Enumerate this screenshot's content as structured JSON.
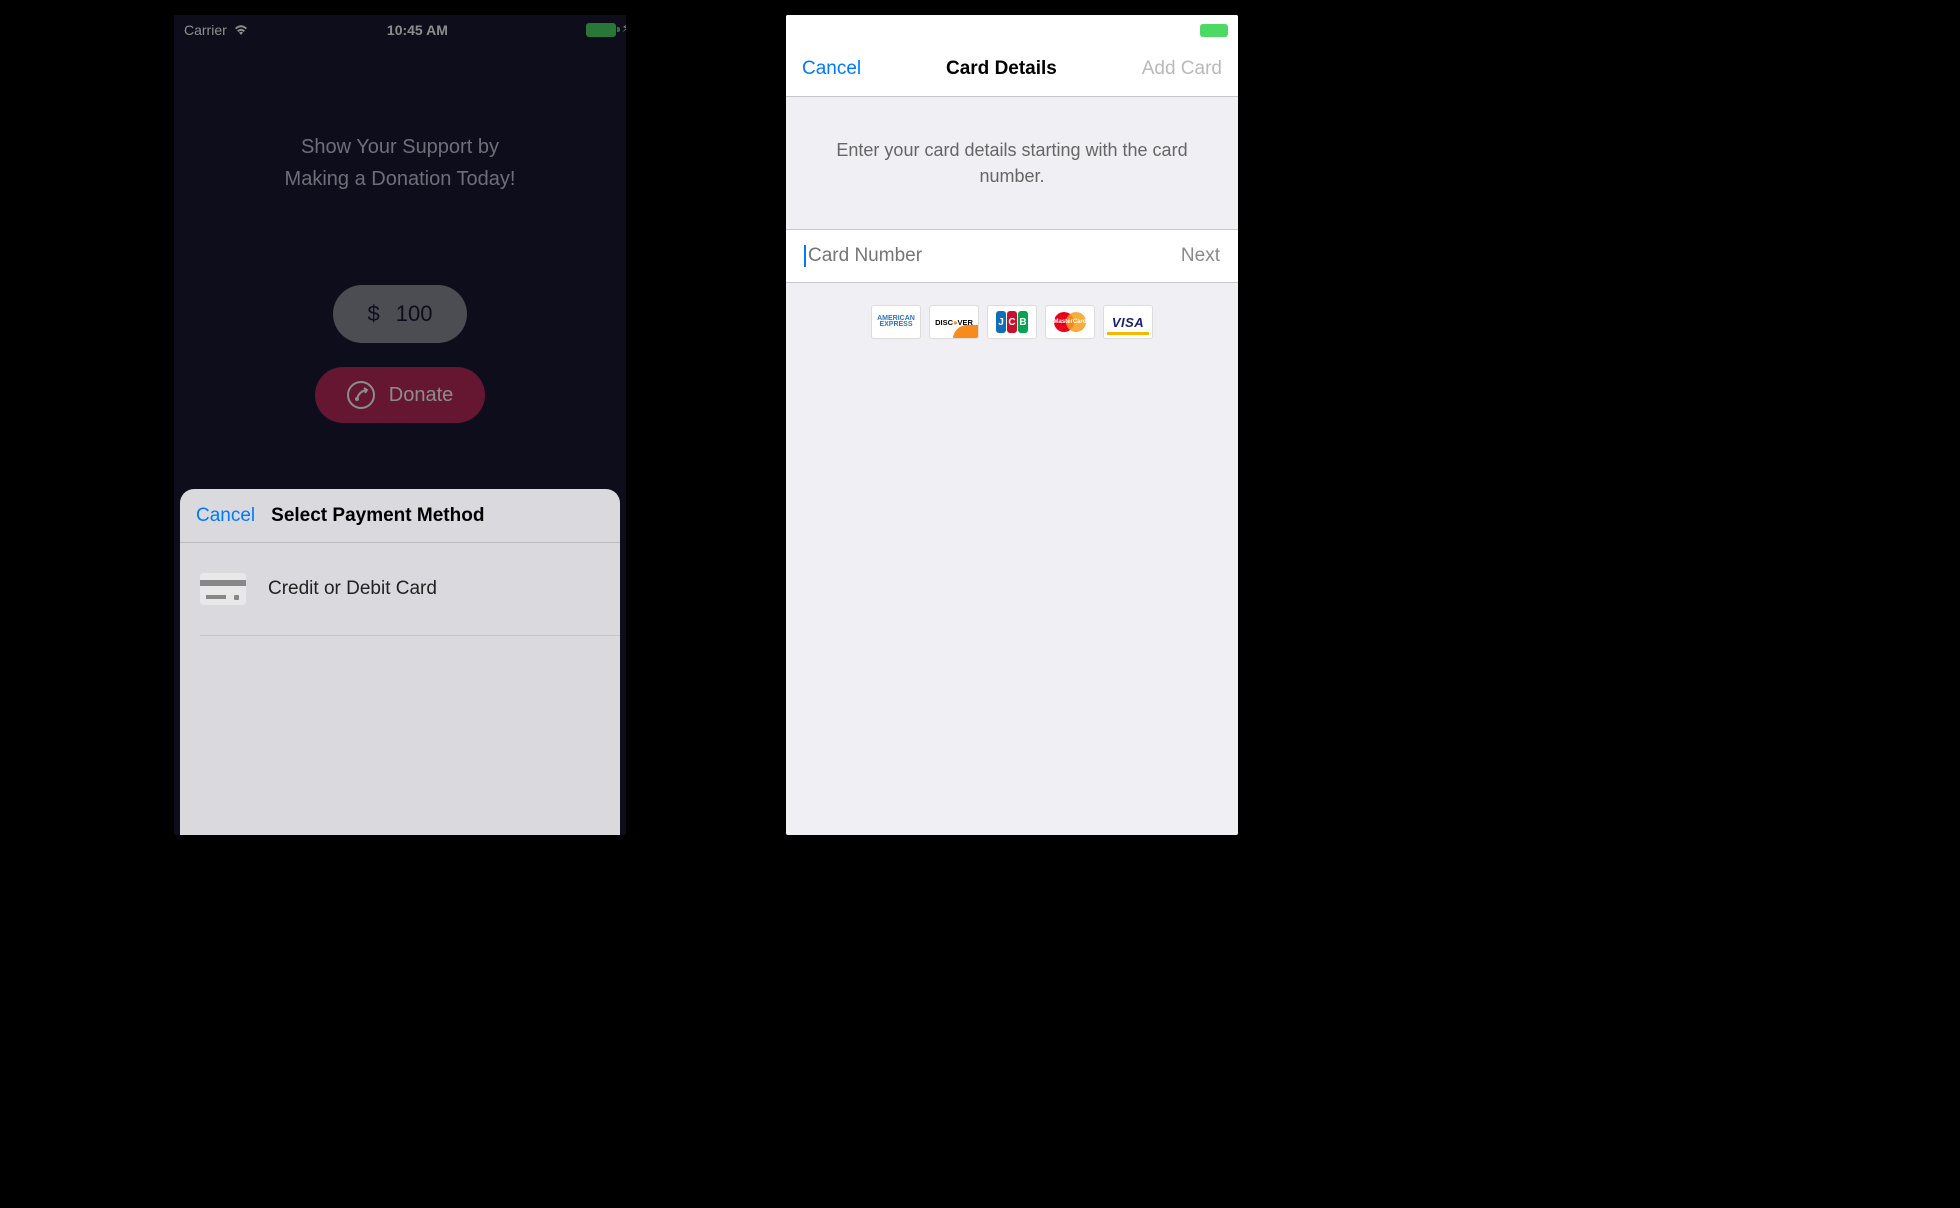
{
  "left": {
    "statusBar": {
      "carrier": "Carrier",
      "time": "10:45 AM"
    },
    "titleLine1": "Show Your Support by",
    "titleLine2": "Making a Donation Today!",
    "amountCurrency": "$",
    "amountValue": "100",
    "donateLabel": "Donate",
    "sheet": {
      "cancel": "Cancel",
      "title": "Select Payment Method",
      "optionLabel": "Credit or Debit Card"
    }
  },
  "right": {
    "nav": {
      "cancel": "Cancel",
      "title": "Card Details",
      "addCard": "Add Card"
    },
    "instruction": "Enter your card details starting with the card number.",
    "input": {
      "placeholder": "Card Number",
      "nextLabel": "Next"
    },
    "cards": {
      "amex": "AMERICAN EXPRESS",
      "discover": "DISCOVER",
      "jcb": "JCB",
      "mastercard": "MasterCard",
      "visa": "VISA"
    }
  }
}
